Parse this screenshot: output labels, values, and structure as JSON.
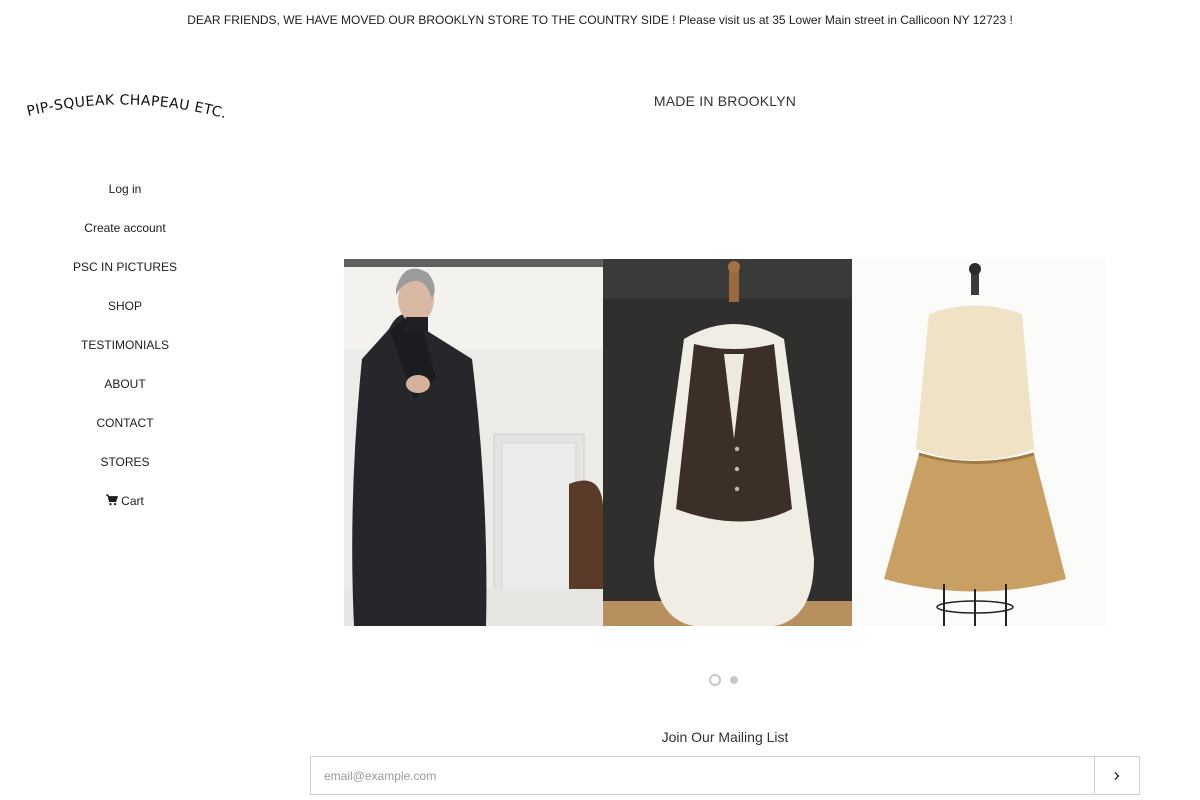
{
  "announcement": {
    "text": "DEAR FRIENDS, WE HAVE MOVED OUR BROOKLYN STORE TO THE COUNTRY SIDE ! Please visit us at 35 Lower Main street in Callicoon NY 12723 !"
  },
  "logo": {
    "text": "PIP-SQUEAK CHAPEAU ETC."
  },
  "sidebar": {
    "items": [
      {
        "label": "Log in"
      },
      {
        "label": "Create account"
      },
      {
        "label": "PSC IN PICTURES"
      },
      {
        "label": "SHOP"
      },
      {
        "label": "TESTIMONIALS"
      },
      {
        "label": "ABOUT"
      },
      {
        "label": "CONTACT"
      },
      {
        "label": "STORES"
      },
      {
        "label": "Cart",
        "icon": "cart-icon"
      }
    ]
  },
  "main": {
    "title": "MADE IN BROOKLYN",
    "slideshow": {
      "slide_count": 2,
      "active_slide": 1,
      "image_alt": "Model in dark coat, brown vest on dress form, tan dress on dress form"
    }
  },
  "newsletter": {
    "title": "Join Our Mailing List",
    "placeholder": "email@example.com",
    "submit_icon": "chevron-right-icon"
  },
  "colors": {
    "text": "#1c1d1d",
    "border": "#cfcfcf",
    "dot": "#c8c8c8"
  }
}
